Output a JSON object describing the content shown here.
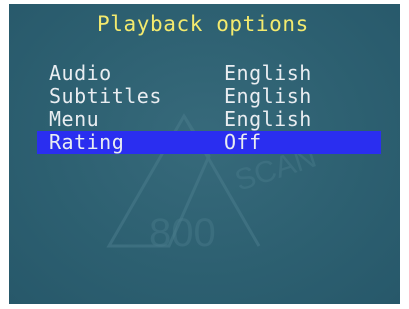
{
  "menu": {
    "title": "Playback options",
    "items": [
      {
        "label": "Audio",
        "value": "English"
      },
      {
        "label": "Subtitles",
        "value": "English"
      },
      {
        "label": "Menu",
        "value": "English"
      },
      {
        "label": "Rating",
        "value": "Off"
      }
    ],
    "selected_index": 3
  },
  "colors": {
    "background": "#2c5e6f",
    "title_text": "#f3ea6e",
    "item_text": "#e9edf1",
    "selection_bar": "#2a2ef0"
  }
}
